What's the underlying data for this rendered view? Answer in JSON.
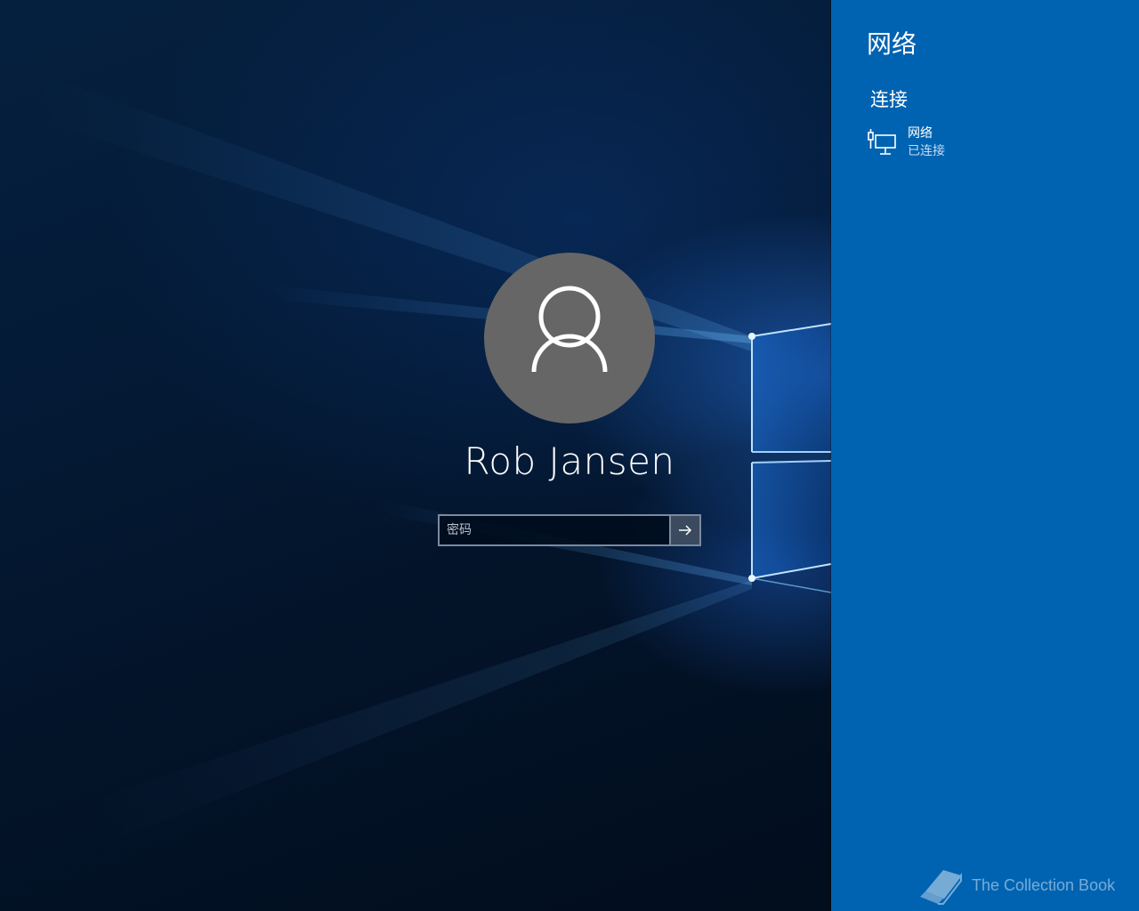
{
  "login": {
    "username": "Rob Jansen",
    "password_placeholder": "密码",
    "avatar_icon": "user-silhouette-icon",
    "submit_icon": "arrow-right-icon"
  },
  "network_flyout": {
    "title": "网络",
    "section_title": "连接",
    "networks": [
      {
        "name": "网络",
        "status": "已连接",
        "icon": "wired-ethernet-icon"
      }
    ]
  },
  "watermark": {
    "text": "The Collection Book",
    "icon": "book-icon"
  },
  "colors": {
    "flyout_background": "#0063b1",
    "avatar_background": "#666666",
    "wallpaper_dark": "#03142a"
  }
}
